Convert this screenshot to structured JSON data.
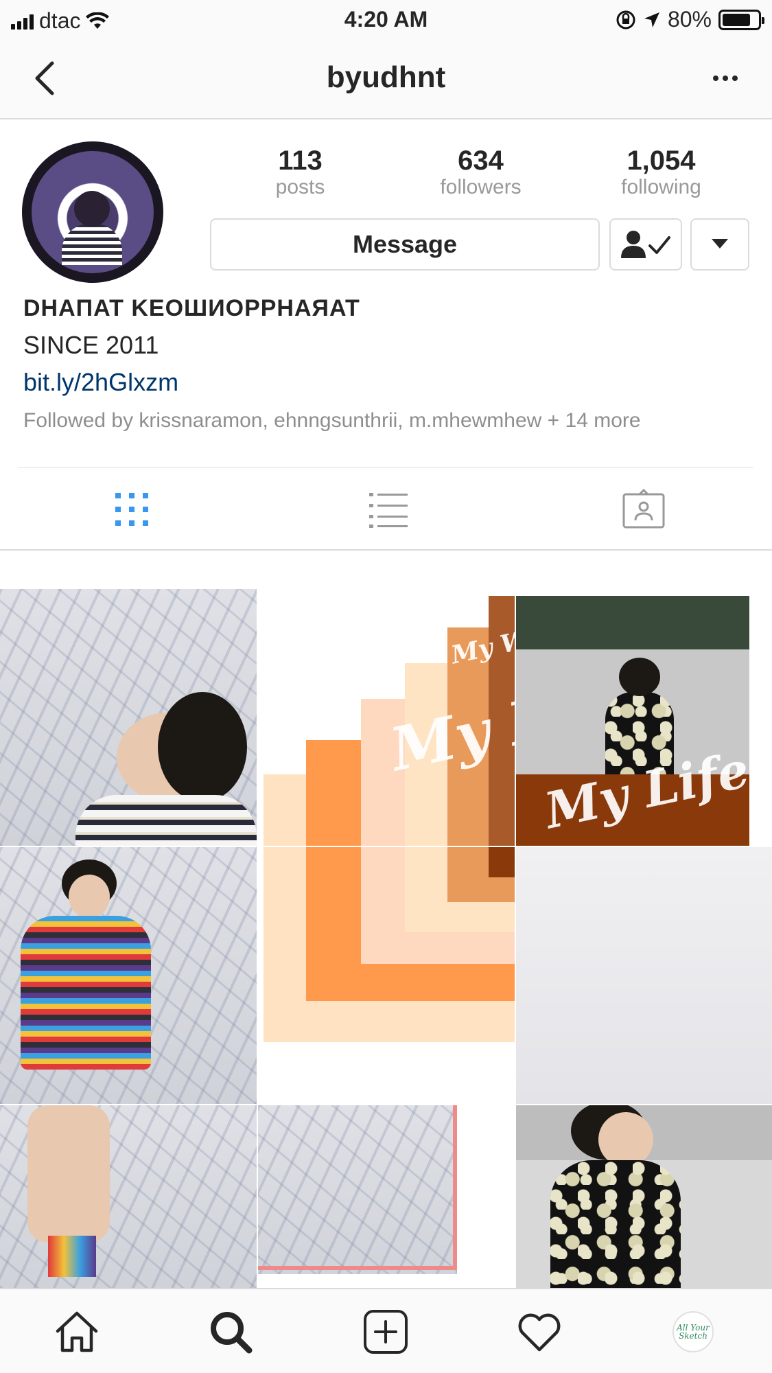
{
  "status_bar": {
    "carrier": "dtac",
    "time": "4:20 AM",
    "battery_percent": "80%",
    "battery_level": 0.8
  },
  "header": {
    "username": "byudhnt",
    "back_icon": "chevron-left-icon",
    "more_icon": "more-horizontal-icon"
  },
  "profile": {
    "stats": [
      {
        "value": "113",
        "label": "posts"
      },
      {
        "value": "634",
        "label": "followers"
      },
      {
        "value": "1,054",
        "label": "following"
      }
    ],
    "message_label": "Message",
    "full_name": "DHAПAT KEOШИOPPHAЯAT",
    "bio_line": "SINCE 2011",
    "link": "bit.ly/2hGlxzm",
    "followed_by": "Followed by krissnaramon, ehnngsunthrii, m.mhewmhew + 14 more"
  },
  "tabs": {
    "items": [
      {
        "icon": "grid-icon",
        "active": true
      },
      {
        "icon": "list-icon",
        "active": false
      },
      {
        "icon": "tagged-icon",
        "active": false
      }
    ],
    "active_color": "#3897f0",
    "inactive_color": "#999999"
  },
  "grid": {
    "overlay_texts": [
      "My World",
      "My Place",
      "My Life"
    ]
  },
  "bottom_nav": {
    "items": [
      "home-icon",
      "search-icon",
      "add-post-icon",
      "heart-icon",
      "profile-avatar"
    ],
    "profile_avatar_text": "All Your Sketch"
  },
  "colors": {
    "link": "#003569",
    "secondary_text": "#8e8e8e",
    "accent": "#3897f0",
    "orange_1": "#ffd8a8",
    "orange_2": "#ff9a4d",
    "orange_3": "#e89a5a",
    "brown": "#8a3a0a"
  }
}
